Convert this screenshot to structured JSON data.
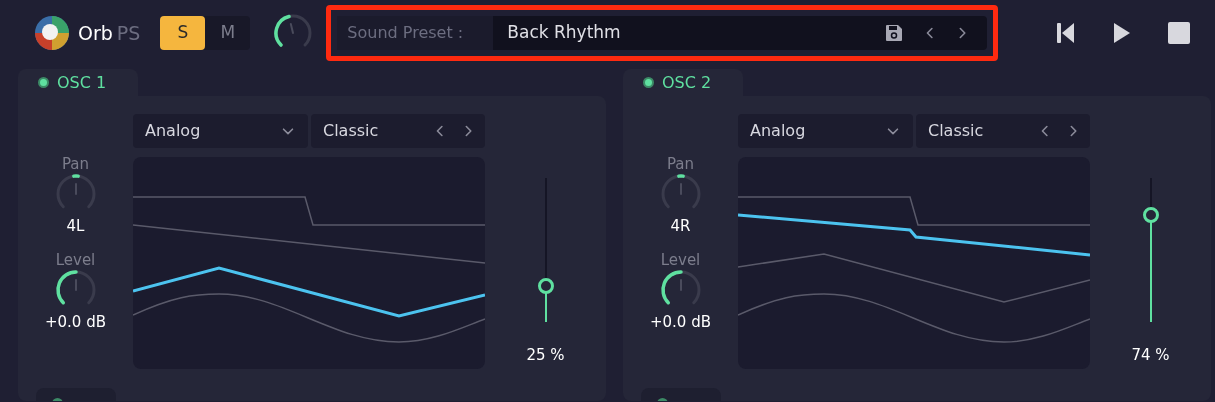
{
  "app": {
    "name": "Orb",
    "suffix": "PS"
  },
  "mode_toggle": [
    {
      "label": "S",
      "selected": true
    },
    {
      "label": "M",
      "selected": false
    }
  ],
  "preset": {
    "label": "Sound Preset :",
    "value": "Back Rhythm",
    "highlighted": true
  },
  "transport": [
    {
      "kind": "previous"
    },
    {
      "kind": "play"
    },
    {
      "kind": "stop"
    }
  ],
  "oscillators": [
    {
      "title": "OSC 1",
      "on": true,
      "type": "Analog",
      "variant": "Classic",
      "pan": {
        "label": "Pan",
        "reading": "4L"
      },
      "level_knob": {
        "label": "Level",
        "reading": "+0.0 dB"
      },
      "mix": {
        "level": 0.25,
        "reading": "25 %"
      },
      "waves": [
        {
          "kind": "square",
          "selected": false
        },
        {
          "kind": "saw",
          "selected": false
        },
        {
          "kind": "triangle",
          "selected": true
        },
        {
          "kind": "sine",
          "selected": false
        }
      ],
      "footer_tab": {
        "on": true
      }
    },
    {
      "title": "OSC 2",
      "on": true,
      "type": "Analog",
      "variant": "Classic",
      "pan": {
        "label": "Pan",
        "reading": "4R"
      },
      "level_knob": {
        "label": "Level",
        "reading": "+0.0 dB"
      },
      "mix": {
        "level": 0.74,
        "reading": "74 %"
      },
      "waves": [
        {
          "kind": "square",
          "selected": false
        },
        {
          "kind": "saw",
          "selected": true
        },
        {
          "kind": "triangle",
          "selected": false
        },
        {
          "kind": "sine",
          "selected": false
        }
      ],
      "footer_tab": {
        "on": true
      }
    }
  ]
}
